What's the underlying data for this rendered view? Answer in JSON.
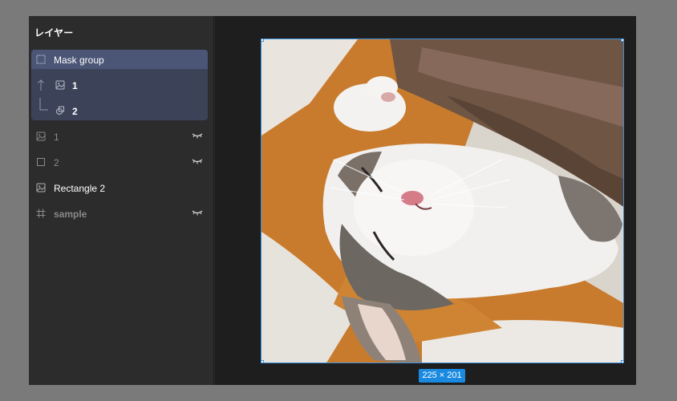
{
  "panel": {
    "title": "レイヤー"
  },
  "layers": {
    "mask_group": {
      "label": "Mask group",
      "icon": "mask-group-icon"
    },
    "mask_child_1": {
      "label": "1",
      "icon": "image-icon"
    },
    "mask_child_2": {
      "label": "2",
      "icon": "component-icon"
    },
    "layer_1": {
      "label": "1",
      "icon": "image-icon",
      "hidden": true
    },
    "layer_2": {
      "label": "2",
      "icon": "rectangle-icon",
      "hidden": true
    },
    "rectangle_2": {
      "label": "Rectangle 2",
      "icon": "image-icon",
      "hidden": false
    },
    "sample": {
      "label": "sample",
      "icon": "frame-icon",
      "hidden": true
    }
  },
  "canvas": {
    "selection_size": "225 × 201",
    "image_subject": "sleeping kitten photo"
  },
  "colors": {
    "selection": "#3f8fd8",
    "badge": "#1a8ae0",
    "group_highlight": "#4b5676",
    "group_body": "#3c4358"
  }
}
